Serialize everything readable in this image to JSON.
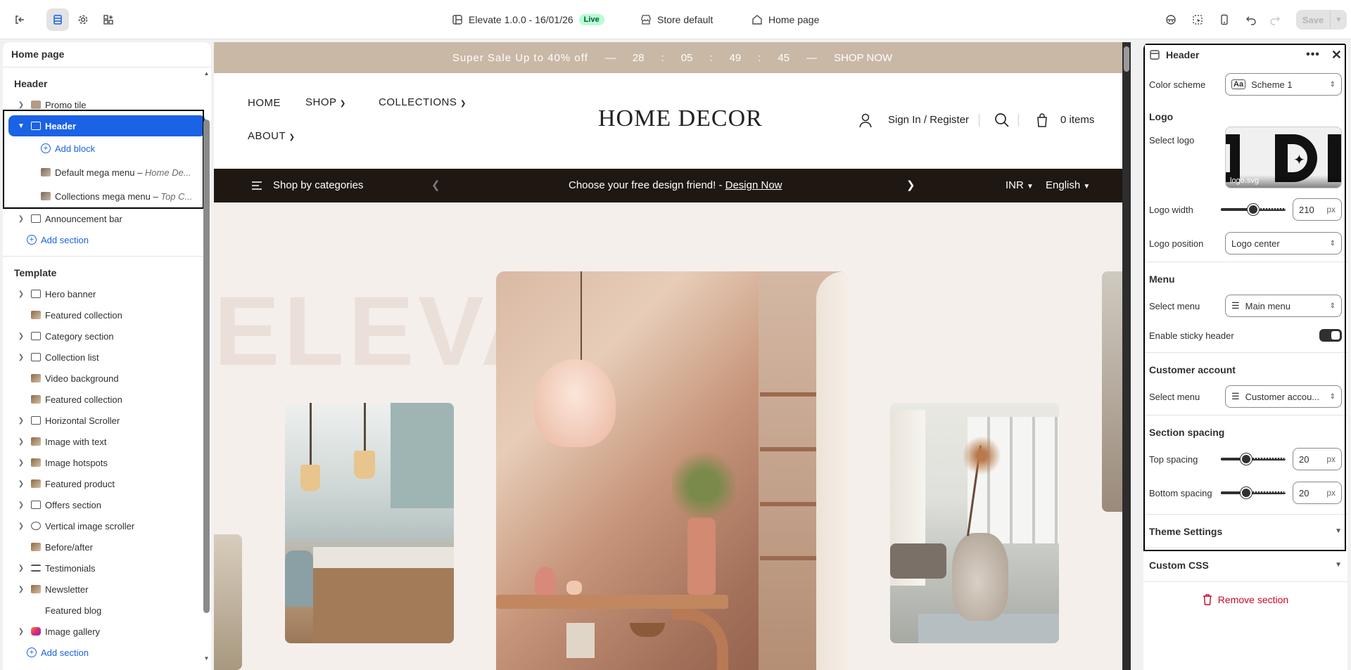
{
  "topbar": {
    "theme_name": "Elevate 1.0.0 - 16/01/26",
    "live_badge": "Live",
    "store": "Store default",
    "page": "Home page",
    "save_label": "Save"
  },
  "left": {
    "title": "Home page",
    "header_group": "Header",
    "header_items": [
      {
        "label": "Promo tile"
      },
      {
        "label": "Header"
      },
      {
        "label": "Announcement bar"
      }
    ],
    "header_blocks": {
      "add_block": "Add block",
      "default_menu": "Default mega menu",
      "default_menu_sub": "Home De...",
      "collections_menu": "Collections mega menu",
      "collections_menu_sub": "Top C..."
    },
    "add_section": "Add section",
    "template_group": "Template",
    "template_items": [
      {
        "label": "Hero banner"
      },
      {
        "label": "Featured collection"
      },
      {
        "label": "Category section"
      },
      {
        "label": "Collection list"
      },
      {
        "label": "Video background"
      },
      {
        "label": "Featured collection"
      },
      {
        "label": "Horizontal Scroller"
      },
      {
        "label": "Image with text"
      },
      {
        "label": "Image hotspots"
      },
      {
        "label": "Featured product"
      },
      {
        "label": "Offers section"
      },
      {
        "label": "Vertical image scroller"
      },
      {
        "label": "Before/after"
      },
      {
        "label": "Testimonials"
      },
      {
        "label": "Newsletter"
      },
      {
        "label": "Featured blog"
      },
      {
        "label": "Image gallery"
      }
    ],
    "add_section_2": "Add section"
  },
  "preview": {
    "promo": {
      "text": "Super Sale Up to 40% off",
      "dash": "—",
      "hours": "28",
      "minutes": "05",
      "seconds": "49",
      "ms": "45",
      "colon": ":",
      "cta": "SHOP NOW"
    },
    "nav": {
      "home": "HOME",
      "shop": "SHOP",
      "collections": "COLLECTIONS",
      "about": "ABOUT",
      "logo": "HOME DECOR",
      "signin": "Sign In / Register",
      "cart": "0 items"
    },
    "catbar": {
      "categories": "Shop by categories",
      "message": "Choose your free design friend! - ",
      "message_link": "Design Now",
      "currency": "INR",
      "language": "English"
    },
    "hero_text": "ELEVAT"
  },
  "right": {
    "title": "Header",
    "color_scheme_label": "Color scheme",
    "color_scheme_value": "Scheme 1",
    "logo_group": "Logo",
    "select_logo_label": "Select logo",
    "logo_file": "logo.svg",
    "logo_width_label": "Logo width",
    "logo_width_value": "210",
    "unit": "px",
    "logo_position_label": "Logo position",
    "logo_position_value": "Logo center",
    "menu_group": "Menu",
    "select_menu_label": "Select menu",
    "select_menu_value": "Main menu",
    "sticky_label": "Enable sticky header",
    "customer_group": "Customer account",
    "customer_menu_label": "Select menu",
    "customer_menu_value": "Customer accou...",
    "spacing_group": "Section spacing",
    "top_spacing_label": "Top spacing",
    "top_spacing_value": "20",
    "bottom_spacing_label": "Bottom spacing",
    "bottom_spacing_value": "20",
    "theme_settings": "Theme Settings",
    "custom_css": "Custom CSS",
    "remove_section": "Remove section"
  }
}
